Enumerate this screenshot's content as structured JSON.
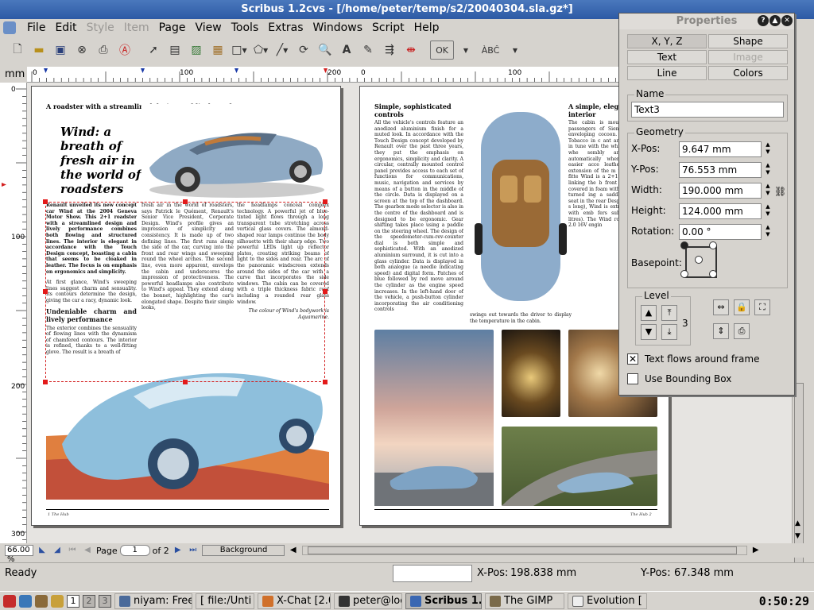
{
  "window": {
    "title": "Scribus 1.2cvs - [/home/peter/temp/s2/20040304.sla.gz*]"
  },
  "menu": [
    "File",
    "Edit",
    "Style",
    "Item",
    "Page",
    "View",
    "Tools",
    "Extras",
    "Windows",
    "Script",
    "Help"
  ],
  "menu_disabled": [
    "Style",
    "Item"
  ],
  "toolbar": {
    "icons": [
      "new-doc-icon",
      "open-folder-icon",
      "save-icon",
      "close-doc-icon",
      "print-icon",
      "pdf-icon",
      "select-arrow-icon",
      "text-frame-icon",
      "image-frame-icon",
      "table-icon",
      "rectangle-icon",
      "polygon-icon",
      "line-icon",
      "rotate-icon",
      "zoom-icon",
      "edit-text-icon",
      "story-editor-icon",
      "link-frames-icon",
      "unlink-frames-icon",
      "pdf-tools-icon",
      "pdf-annotation-icon"
    ],
    "ok_label": "OK",
    "spell_label": "ÀBĈ"
  },
  "rulers": {
    "unit": "mm",
    "h_labels": [
      "0",
      "100",
      "200",
      "0",
      "100"
    ],
    "v_labels": [
      "0",
      "100",
      "200",
      "300"
    ]
  },
  "document": {
    "left_page": {
      "kicker": "A roadster with a streamlined design and lively performance",
      "headline": "Wind: a breath of fresh air in the world of roadsters",
      "col1_lead": "Renault unveiled its new concept car Wind at the 2004 Geneva Motor Show. This 2+1 roadster with a streamlined design and lively performance combines both flowing and structured lines. The interior is elegant in accordance with the Touch Design concept, boasting a cabin that seems to be cloaked in leather. The focus is on emphasis on ergonomics and simplicity.",
      "col1_body": "At first glance, Wind's sweeping lines suggest charm and sensuality. Its contours determine the design, giving the car a racy, dynamic look.",
      "col1_subhead": "Undeniable charm and lively performance",
      "col1_body2": "The exterior combines the sensuality of flowing lines with the dynamism of chamfered contours. The interior is refined, thanks to a well-fitting glove. The result is a breath of",
      "col2_body": "fresh air in the world of roadsters, says Patrick le Quément, Renault's Senior Vice President, Corporate Design. Wind's profile gives an impression of simplicity and consistency. It is made up of two defining lines. The first runs along the side of the car, curving into the front and rear wings and sweeping round the wheel arches. The second line, even more apparent, envelops the cabin and underscores the impression of protectiveness. The powerful headlamps also contribute to Wind's appeal. They extend along the bonnet, highlighting the car's elongated shape. Despite their simple looks,",
      "col3_body": "the headlamps conceal complex technology. A powerful jet of blue-tinted light flows through a long transparent tube stretching across vertical glass covers. The almond-shaped rear lamps continue the body silhouette with their sharp edge. Two powerful LEDs light up reflector plates, creating striking beams of light to the sides and rear. The arc of the panoramic windscreen extends around the sides of the car with a curve that incorporates the side windows. The cabin can be covered with a triple thickness fabric roof including a rounded rear glass window.",
      "col3_quote": "The colour of Wind's bodywork is Aquamarine.",
      "folio": "1  The Hub"
    },
    "right_page": {
      "col1_head": "Simple, sophisticated controls",
      "col1_body": "All the vehicle's controls feature an anodized aluminium finish for a muted look. In accordance with the Touch Design concept developed by Renault over the past three years, they put the emphasis on ergonomics, simplicity and clarity. A circular, centrally mounted control panel provides access to each set of functions for communications, music, navigation and services by means of a button in the middle of the circle. Data is displayed on a screen at the top of the dashboard. The gearbox mode selector is also in the centre of the dashboard and is designed to be ergonomic. Gear shifting takes place using a paddle on the steering wheel. The design of the speedometer-cum-rev-counter dial is both simple and sophisticated. With an anodized aluminium surround, it is cut into a glass cylinder. Data is displayed in both analogue (a needle indicating speed) and digital form. Patches of blue followed by red move around the cylinder as the engine speed increases. In the left-hand door of the vehicle, a push-button cylinder incorporating the air conditioning controls",
      "col2_tail": "swings out towards the driver to display the temperature in the cabin.",
      "col3_head": "A simple, elegant interior",
      "col3_body": "The cabin is mould driver and passengers of Sienna-coloured le enveloping cocoon. The er seats, Tobacco in c ant and comfortable. in tune with the while the steering whe sembly are adjustable automatically when opened for easier acce leather-covered roll extension of the m which they are fitte Wind is a 2+1 roadst section linking the b front seats is made covered in foam with unhooked and turned ing a saddle shape third seat in the rear Despite its compact s long), Wind is extrem boot, lined with emb fers substantial lugga litres). The Wind roadster 136bhp 2.0 16V engin",
      "folio": "The Hub   2"
    }
  },
  "navbar": {
    "zoom": "66.00 %",
    "page_label": "Page",
    "page_value": "1",
    "of_label": "of 2",
    "layer": "Background"
  },
  "status": {
    "ready": "Ready",
    "xpos_label": "X-Pos:",
    "xpos_value": "198.838 mm",
    "ypos_label": "Y-Pos:",
    "ypos_value": "67.348 mm"
  },
  "properties": {
    "title": "Properties",
    "tabs": [
      "X, Y, Z",
      "Shape",
      "Text",
      "Image",
      "Line",
      "Colors"
    ],
    "tab_disabled": "Image",
    "name_group": "Name",
    "name_value": "Text3",
    "geometry_group": "Geometry",
    "fields": [
      {
        "label": "X-Pos:",
        "value": "9.647 mm"
      },
      {
        "label": "Y-Pos:",
        "value": "76.553 mm"
      },
      {
        "label": "Width:",
        "value": "190.000 mm"
      },
      {
        "label": "Height:",
        "value": "124.000 mm"
      },
      {
        "label": "Rotation:",
        "value": "0.00 °"
      }
    ],
    "basepoint_label": "Basepoint:",
    "level_group": "Level",
    "level_value": "3",
    "text_flows_label": "Text flows around frame",
    "text_flows_checked": true,
    "bounding_box_label": "Use Bounding Box",
    "bounding_box_checked": false
  },
  "taskbar": {
    "desktops": [
      "1",
      "2",
      "3"
    ],
    "tasks": [
      {
        "label": "niyam: Freec",
        "active": false
      },
      {
        "label": "[ file:/Unti",
        "active": false
      },
      {
        "label": "X-Chat [2.0",
        "active": false
      },
      {
        "label": "peter@locall",
        "active": false
      },
      {
        "label": "Scribus 1.",
        "active": true
      },
      {
        "label": "The GIMP",
        "active": false
      },
      {
        "label": "Evolution [",
        "active": false
      }
    ],
    "clock": "0:50:29"
  },
  "colors": {
    "title_blue": "#3a67b2",
    "selection_red": "#e31a1a",
    "car_blue": "#7fa8c9"
  }
}
